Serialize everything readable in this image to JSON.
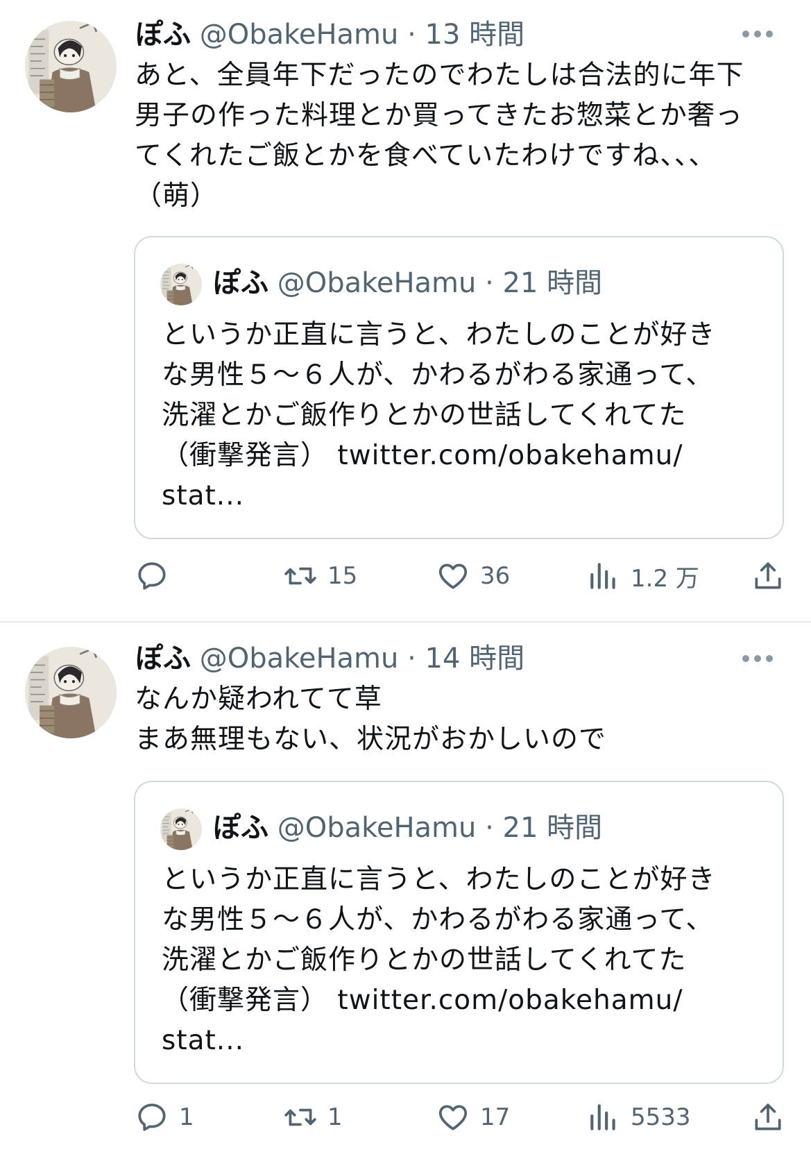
{
  "tweets": [
    {
      "author": {
        "name": "ぽふ",
        "handle": "@ObakeHamu"
      },
      "separator": "·",
      "time": "13 時間",
      "text": "あと、全員年下だったのでわたしは合法的に年下\n男子の作った料理とか買ってきたお惣菜とか奢っ\nてくれたご飯とかを食べていたわけですね、、、\n（萌）",
      "quote": {
        "author": {
          "name": "ぽふ",
          "handle": "@ObakeHamu"
        },
        "separator": "·",
        "time": "21 時間",
        "text": "というか正直に言うと、わたしのことが好き\nな男性５〜６人が、かわるがわる家通って、\n洗濯とかご飯作りとかの世話してくれてた\n（衝撃発言） twitter.com/obakehamu/\nstat..."
      },
      "actions": {
        "reply": {
          "icon": "reply-icon",
          "count": ""
        },
        "retweet": {
          "icon": "retweet-icon",
          "count": "15"
        },
        "like": {
          "icon": "heart-icon",
          "count": "36"
        },
        "views": {
          "icon": "views-icon",
          "count": "1.2 万"
        },
        "share": {
          "icon": "share-icon"
        }
      }
    },
    {
      "author": {
        "name": "ぽふ",
        "handle": "@ObakeHamu"
      },
      "separator": "·",
      "time": "14 時間",
      "text": "なんか疑われてて草\nまあ無理もない、状況がおかしいので",
      "quote": {
        "author": {
          "name": "ぽふ",
          "handle": "@ObakeHamu"
        },
        "separator": "·",
        "time": "21 時間",
        "text": "というか正直に言うと、わたしのことが好き\nな男性５〜６人が、かわるがわる家通って、\n洗濯とかご飯作りとかの世話してくれてた\n（衝撃発言） twitter.com/obakehamu/\nstat..."
      },
      "actions": {
        "reply": {
          "icon": "reply-icon",
          "count": "1"
        },
        "retweet": {
          "icon": "retweet-icon",
          "count": "1"
        },
        "like": {
          "icon": "heart-icon",
          "count": "17"
        },
        "views": {
          "icon": "views-icon",
          "count": "5533"
        },
        "share": {
          "icon": "share-icon"
        }
      }
    }
  ],
  "colors": {
    "text": "#0f1419",
    "secondary": "#536471",
    "border": "#cfd9de"
  }
}
